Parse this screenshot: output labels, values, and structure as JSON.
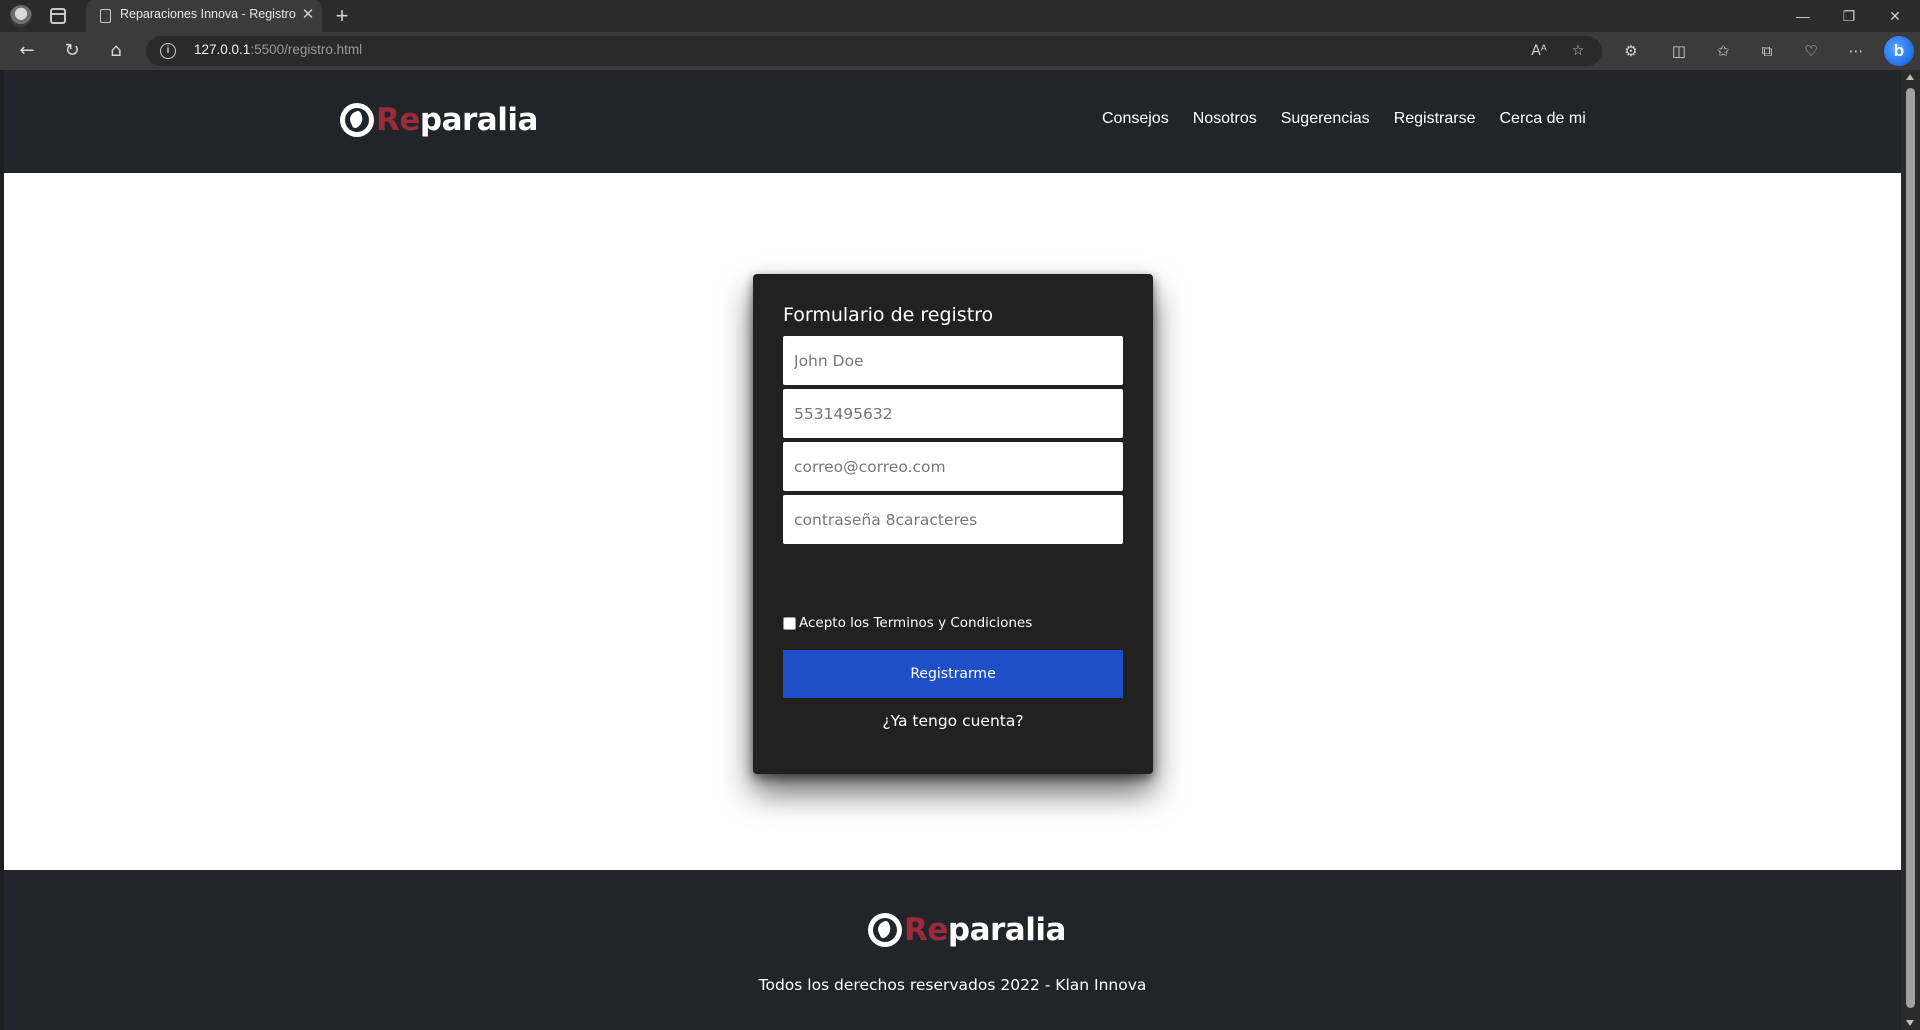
{
  "browser": {
    "tab_title": "Reparaciones Innova - Registro",
    "tab_close": "✕",
    "new_tab": "+",
    "url_host": "127.0.0.1",
    "url_path": ":5500/registro.html",
    "window_controls": [
      "—",
      "❐",
      "✕"
    ],
    "icons": [
      "back-icon",
      "refresh-icon",
      "home-icon",
      "info-icon",
      "read-aloud-icon",
      "favorite-star-icon",
      "extensions-icon",
      "split-screen-icon",
      "favorites-icon",
      "collections-icon",
      "browser-essentials-icon",
      "more-icon",
      "bing-copilot-icon"
    ]
  },
  "header": {
    "logo": {
      "prefix": "Re",
      "suffix": "paralia"
    },
    "nav": [
      {
        "label": "Consejos"
      },
      {
        "label": "Nosotros"
      },
      {
        "label": "Sugerencias"
      },
      {
        "label": "Registrarse"
      },
      {
        "label": "Cerca de mi"
      }
    ]
  },
  "form": {
    "title": "Formulario de registro",
    "name_placeholder": "John Doe",
    "phone_placeholder": "5531495632",
    "email_placeholder": "correo@correo.com",
    "password_placeholder": "contraseña 8caracteres",
    "terms_label": "Acepto los Terminos y Condiciones",
    "terms_checked": false,
    "submit_label": "Registrarme",
    "login_link": "¿Ya tengo cuenta?"
  },
  "footer": {
    "logo": {
      "prefix": "Re",
      "suffix": "paralia"
    },
    "copyright": "Todos los derechos reservados 2022 - Klan Innova"
  },
  "colors": {
    "header_bg": "#212428",
    "card_bg": "#212121",
    "brand_accent": "#9b2a3b",
    "button_blue": "#1f4fc7"
  }
}
